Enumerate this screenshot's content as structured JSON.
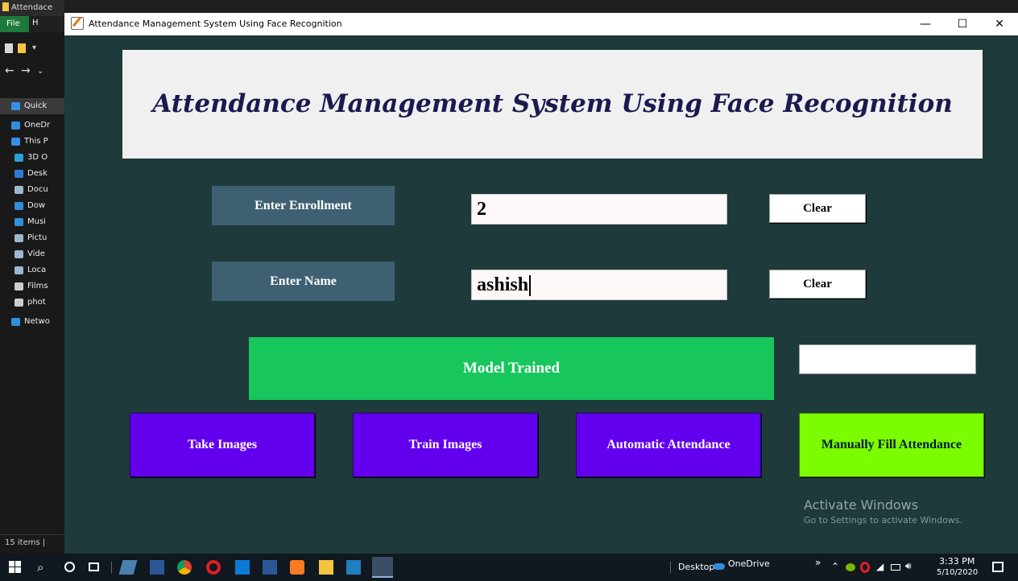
{
  "explorer": {
    "title": "Attendace",
    "file_tab": "File",
    "h_tab": "H",
    "status": "15 items",
    "items": [
      {
        "label": "Quick",
        "icon": "star-icon",
        "color": "#3a8ee6"
      },
      {
        "label": "OneDr",
        "icon": "cloud-icon",
        "color": "#2f8fdb"
      },
      {
        "label": "This P",
        "icon": "computer-icon",
        "color": "#3a8ee6"
      },
      {
        "label": "3D O",
        "icon": "cube-icon",
        "color": "#2aa1d6"
      },
      {
        "label": "Desk",
        "icon": "desktop-icon",
        "color": "#2e7bd6"
      },
      {
        "label": "Docu",
        "icon": "document-icon",
        "color": "#9db7d0"
      },
      {
        "label": "Dow",
        "icon": "download-icon",
        "color": "#2f8fdb"
      },
      {
        "label": "Musi",
        "icon": "music-icon",
        "color": "#2f8fdb"
      },
      {
        "label": "Pictu",
        "icon": "pictures-icon",
        "color": "#9db7d0"
      },
      {
        "label": "Vide",
        "icon": "video-icon",
        "color": "#9db7d0"
      },
      {
        "label": "Loca",
        "icon": "drive-icon",
        "color": "#9db7d0"
      },
      {
        "label": "Films",
        "icon": "drive-icon",
        "color": "#cccccc"
      },
      {
        "label": "phot",
        "icon": "drive-icon",
        "color": "#cccccc"
      },
      {
        "label": "Netwo",
        "icon": "network-icon",
        "color": "#2f8fdb"
      }
    ]
  },
  "window": {
    "title": "Attendance Management System Using Face Recognition",
    "minimize": "—",
    "maximize": "☐",
    "close": "✕"
  },
  "header": {
    "title": "Attendance Management System Using Face Recognition"
  },
  "form": {
    "enrollment_label": "Enter Enrollment",
    "enrollment_value": "2",
    "name_label": "Enter Name",
    "name_value": "ashish",
    "clear1": "Clear",
    "clear2": "Clear"
  },
  "status": {
    "message": "Model Trained",
    "side_value": ""
  },
  "actions": {
    "take_images": "Take Images",
    "train_images": "Train Images",
    "automatic_attendance": "Automatic Attendance",
    "manual_attendance": "Manually Fill Attendance"
  },
  "watermark": {
    "line1": "Activate Windows",
    "line2": "Go to Settings to activate Windows."
  },
  "taskbar": {
    "desktop": "Desktop",
    "onedrive": "OneDrive",
    "time": "3:33 PM",
    "date": "5/10/2020",
    "chevron": "»"
  },
  "colors": {
    "app_bg": "#1e3a3a",
    "label_bg": "#3f6072",
    "status_bg": "#17c65d",
    "action_bg": "#6200ee",
    "manual_bg": "#7cfc00",
    "title_color": "#1a1a4f"
  }
}
